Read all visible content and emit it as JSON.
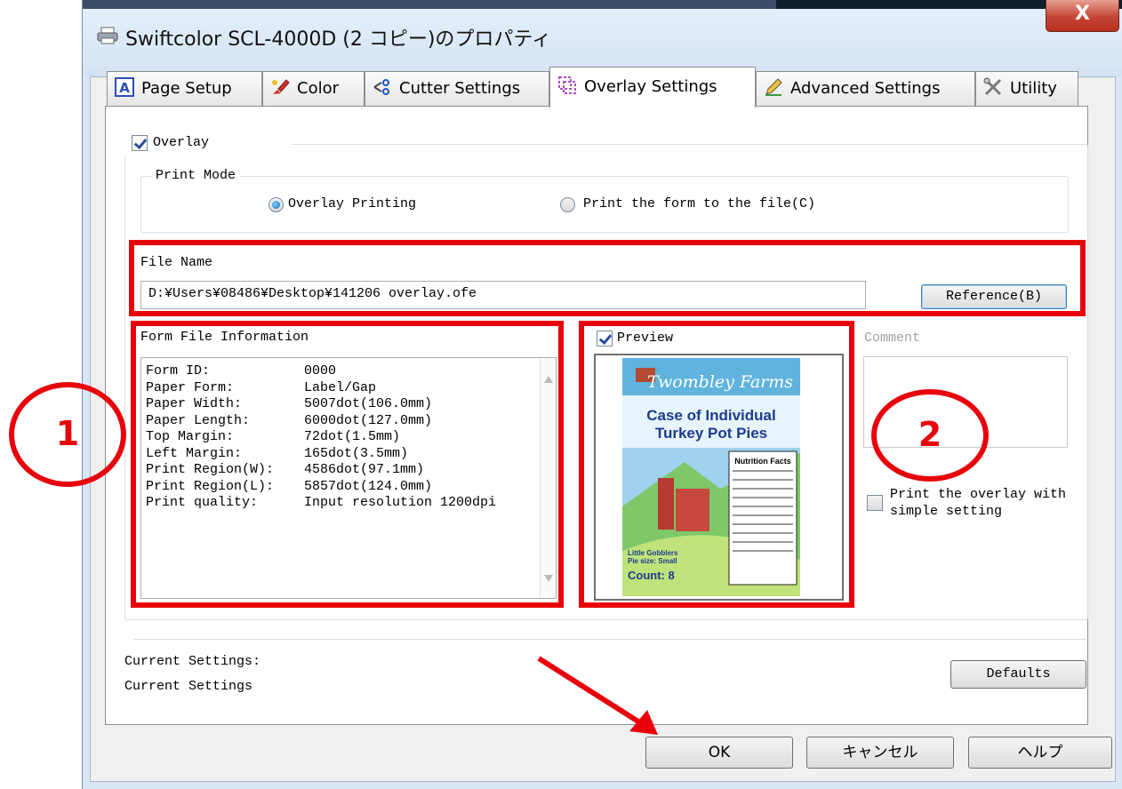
{
  "window": {
    "title": "Swiftcolor SCL-4000D (2 コピー)のプロパティ",
    "close_label": "X"
  },
  "tabs": [
    {
      "label": "Page Setup",
      "icon": "page-setup-icon"
    },
    {
      "label": "Color",
      "icon": "color-brush-icon"
    },
    {
      "label": "Cutter Settings",
      "icon": "cutter-icon"
    },
    {
      "label": "Overlay Settings",
      "icon": "overlay-icon",
      "active": true
    },
    {
      "label": "Advanced Settings",
      "icon": "advanced-pencil-icon"
    },
    {
      "label": "Utility",
      "icon": "utility-tools-icon"
    }
  ],
  "overlay": {
    "checkbox_label": "Overlay",
    "checked": true,
    "print_mode": {
      "group_label": "Print Mode",
      "options": [
        "Overlay Printing",
        "Print the form to the file(C)"
      ],
      "selected": "Overlay Printing"
    },
    "file_name": {
      "label": "File Name",
      "value": "D:¥Users¥08486¥Desktop¥141206 overlay.ofe",
      "reference_button": "Reference(B)"
    },
    "form_file_info": {
      "label": "Form File Information",
      "rows": [
        {
          "key": "Form ID:",
          "value": "0000"
        },
        {
          "key": "Paper Form:",
          "value": "Label/Gap"
        },
        {
          "key": "Paper Width:",
          "value": "5007dot(106.0mm)"
        },
        {
          "key": "Paper Length:",
          "value": "6000dot(127.0mm)"
        },
        {
          "key": "Top Margin:",
          "value": "72dot(1.5mm)"
        },
        {
          "key": "Left Margin:",
          "value": "165dot(3.5mm)"
        },
        {
          "key": "Print Region(W):",
          "value": "4586dot(97.1mm)"
        },
        {
          "key": "Print Region(L):",
          "value": "5857dot(124.0mm)"
        },
        {
          "key": "Print quality:",
          "value": "Input resolution 1200dpi"
        }
      ]
    },
    "preview": {
      "checkbox_label": "Preview",
      "checked": true,
      "label_brand": "Twombley Farms",
      "label_title_1": "Case of Individual",
      "label_title_2": "Turkey Pot Pies",
      "label_facts": "Nutrition Facts",
      "label_sub_1": "Little Gobblers",
      "label_sub_2": "Pie size: Small",
      "label_count": "Count: 8"
    },
    "comment": {
      "label": "Comment",
      "value": ""
    },
    "simple_setting": {
      "label_line1": "Print the overlay with",
      "label_line2": "simple setting",
      "checked": false
    }
  },
  "current_settings": {
    "label": "Current Settings:",
    "value": "Current Settings",
    "defaults_button": "Defaults"
  },
  "footer": {
    "ok": "OK",
    "cancel": "キャンセル",
    "help": "ヘルプ"
  },
  "annotations": {
    "circle_1": "1",
    "circle_2": "2",
    "highlight_color": "#e8000b"
  }
}
